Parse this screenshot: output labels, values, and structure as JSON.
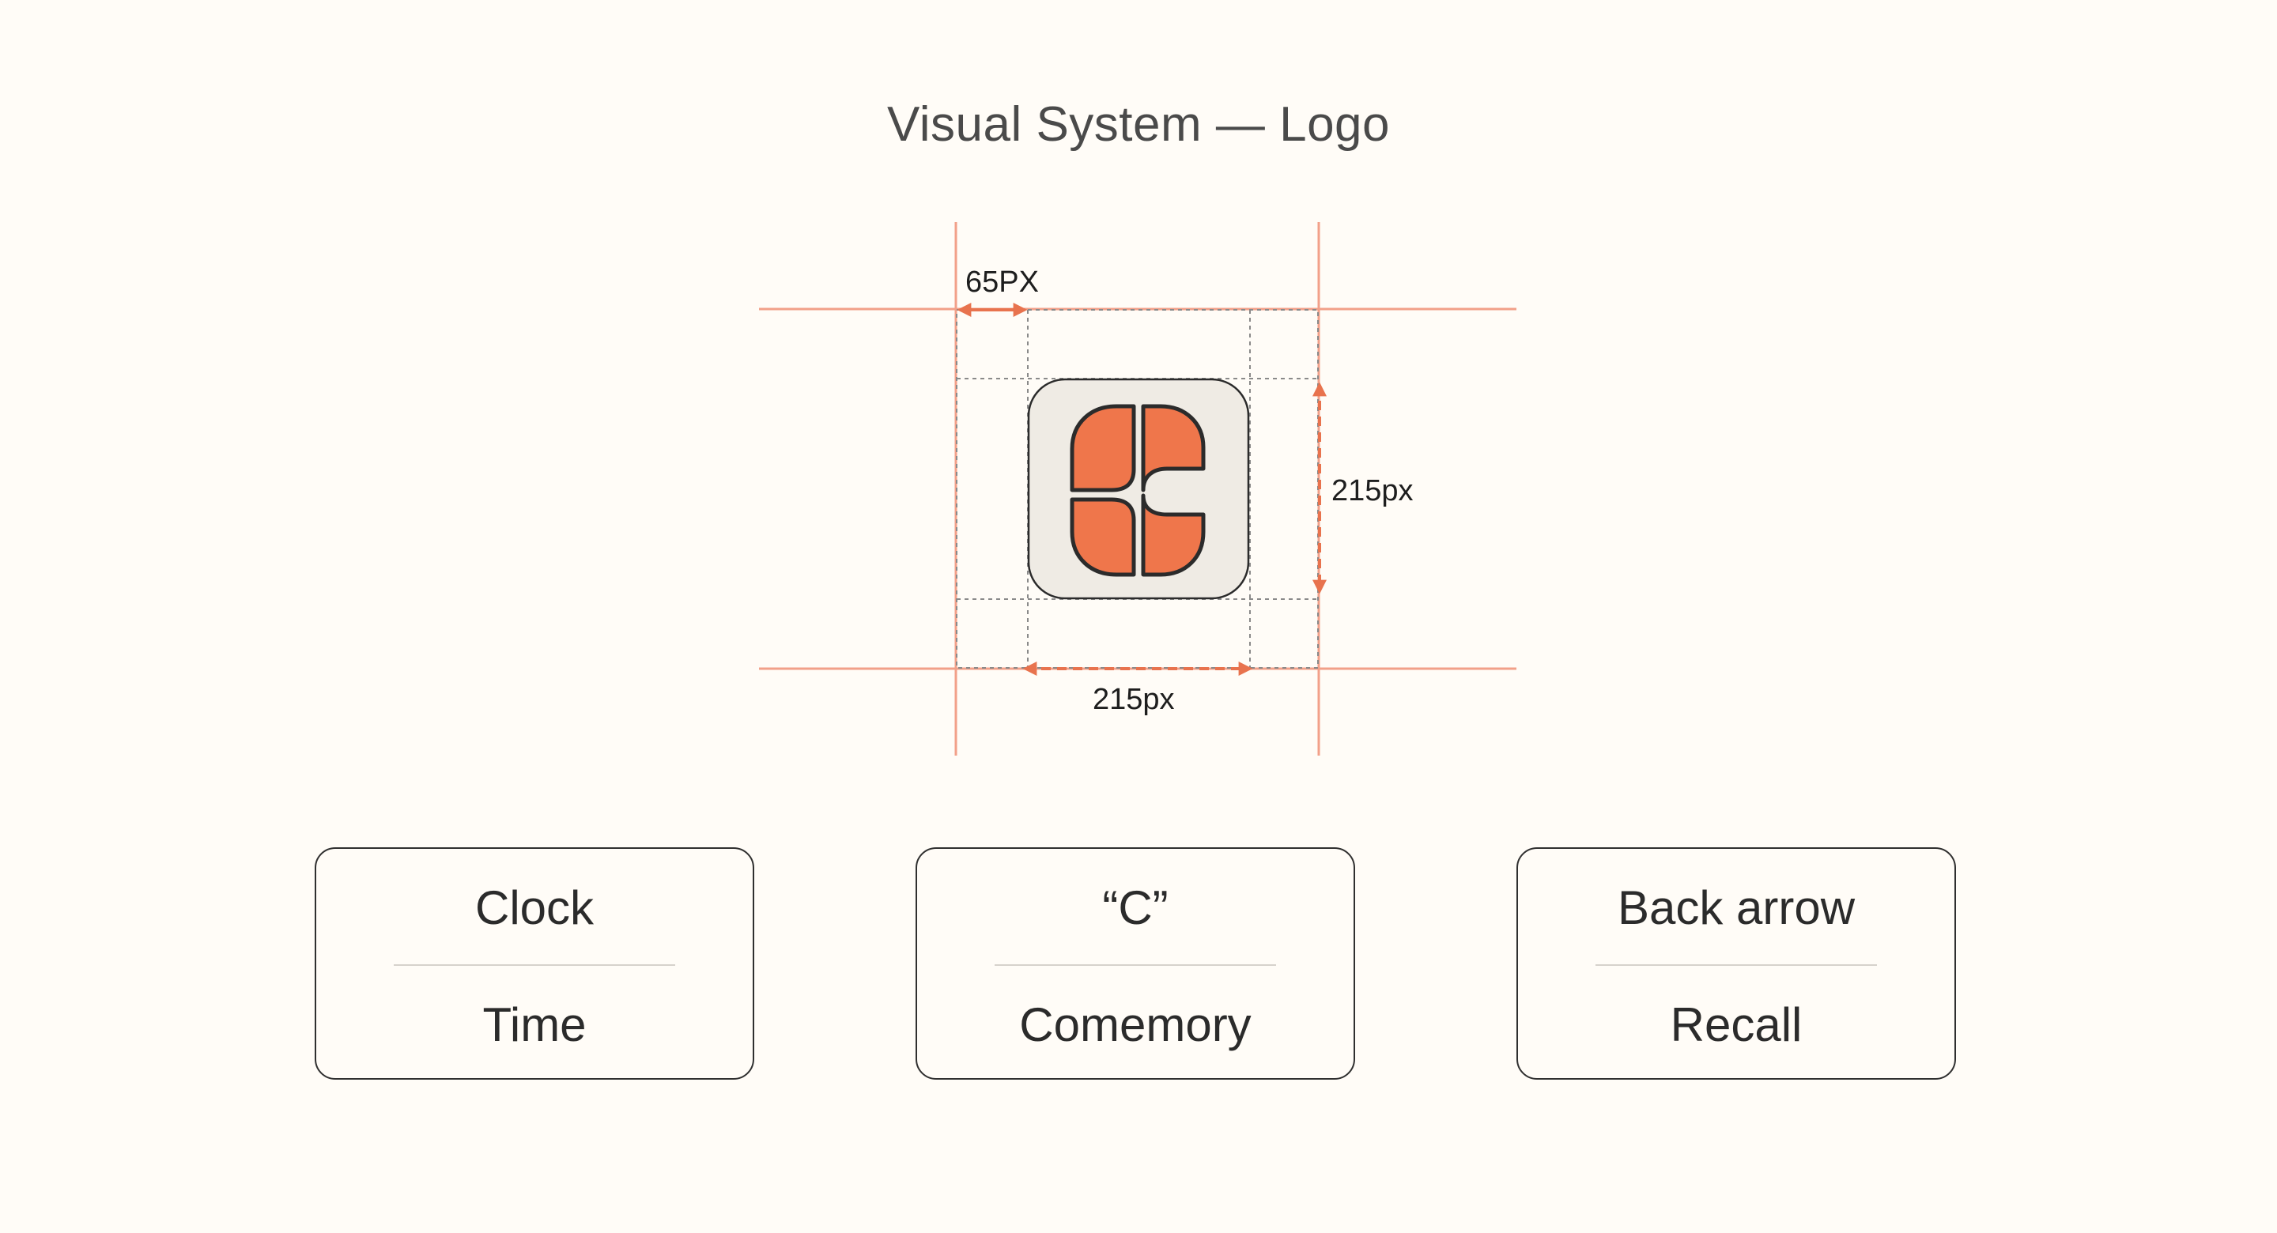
{
  "page": {
    "title": "Visual System — Logo"
  },
  "colors": {
    "background": "#fffcf7",
    "guide_line": "#f2a089",
    "arrow": "#e8734e",
    "logo_orange": "#ef764b",
    "logo_tile": "#efebe4",
    "stroke": "#2b2b2b"
  },
  "diagram": {
    "margin_label": "65PX",
    "height_label": "215px",
    "width_label": "215px"
  },
  "cards": [
    {
      "top": "Clock",
      "bottom": "Time",
      "icon": "clock"
    },
    {
      "top": "“C”",
      "bottom": "Comemory",
      "icon": "c-letter"
    },
    {
      "top": "Back arrow",
      "bottom": "Recall",
      "icon": "back-arrow"
    }
  ]
}
